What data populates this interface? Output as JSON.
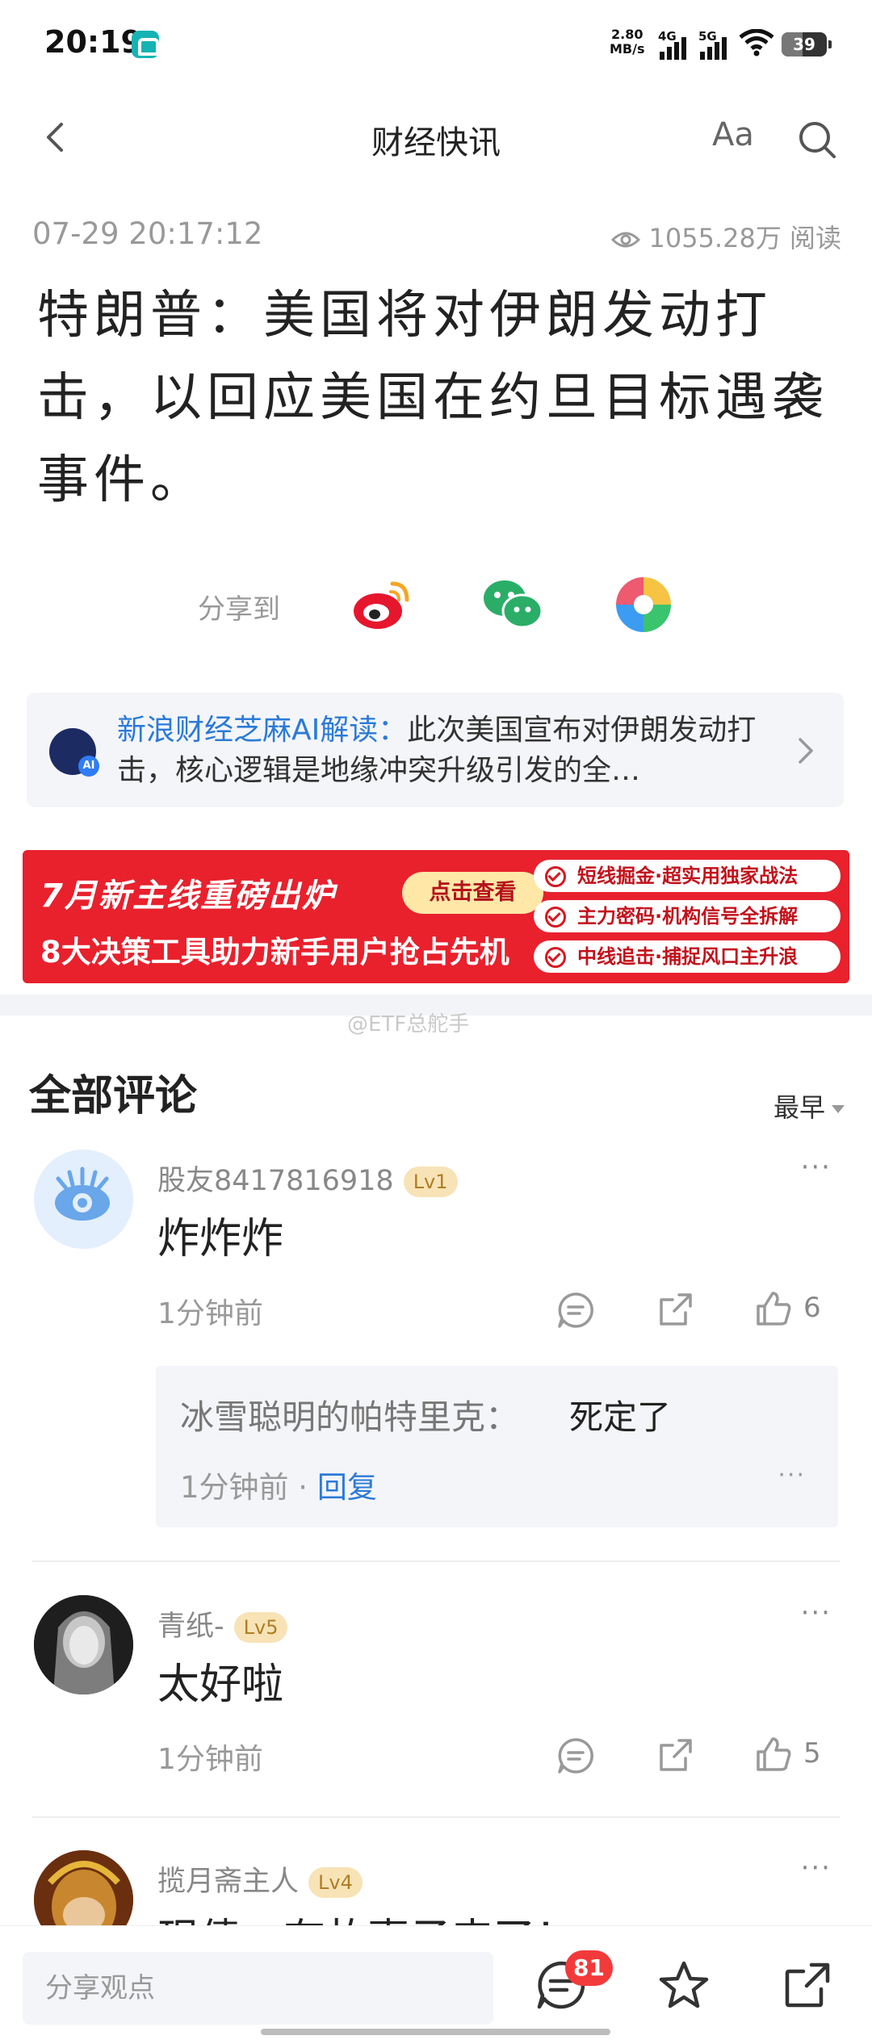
{
  "status": {
    "time": "20:19",
    "speed_value": "2.80",
    "speed_unit": "MB/s",
    "net1": "4G",
    "net2": "5G",
    "battery": "39"
  },
  "nav": {
    "title": "财经快讯",
    "font_label": "Aa"
  },
  "article": {
    "datetime": "07-29 20:17:12",
    "views": "1055.28万 阅读",
    "headline": "特朗普：美国将对伊朗发动打击，以回应美国在约旦目标遇袭事件。"
  },
  "share": {
    "label": "分享到",
    "targets": [
      "weibo-icon",
      "wechat-icon",
      "moments-icon"
    ]
  },
  "ai": {
    "label": "新浪财经芝麻AI解读：",
    "text": "此次美国宣布对伊朗发动打击，核心逻辑是地缘冲突升级引发的全…"
  },
  "banner": {
    "line1": "7月新主线重磅出炉",
    "button": "点击查看",
    "line2": "8大决策工具助力新手用户抢占先机",
    "pills": [
      "短线掘金·超实用独家战法",
      "主力密码·机构信号全拆解",
      "中线追击·捕捉风口主升浪"
    ]
  },
  "watermark": "@ETF总舵手",
  "comments_section": {
    "title": "全部评论",
    "sort": "最早"
  },
  "comments": [
    {
      "user": "股友8417816918",
      "level": "Lv1",
      "text": "炸炸炸",
      "time": "1分钟前",
      "likes": "6",
      "reply": {
        "name": "冰雪聪明的帕特里克：",
        "text": "死定了",
        "time": "1分钟前",
        "action": "回复"
      }
    },
    {
      "user": "青纸-",
      "level": "Lv5",
      "text": "太好啦",
      "time": "1分钟前",
      "likes": "5"
    },
    {
      "user": "揽月斋主人",
      "level": "Lv4",
      "text": "现债，有故事子来了！"
    }
  ],
  "bottom": {
    "placeholder": "分享观点",
    "comment_count": "81"
  },
  "colors": {
    "accent_blue": "#2b7ad8",
    "banner_red": "#e8212d",
    "badge_red": "#f23a3a"
  }
}
